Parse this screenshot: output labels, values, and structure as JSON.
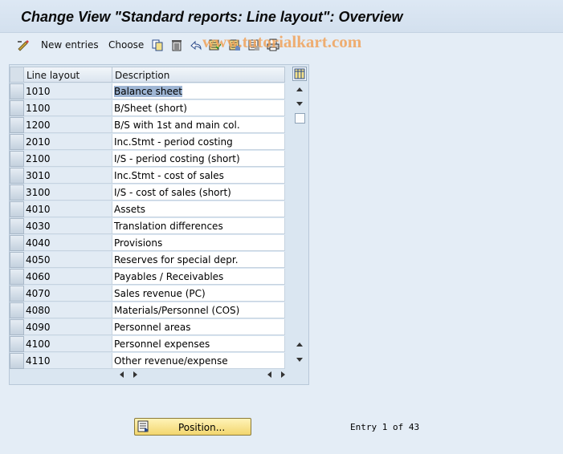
{
  "window": {
    "title": "Change View \"Standard reports: Line layout\": Overview"
  },
  "toolbar": {
    "new_entries_label": "New entries",
    "choose_label": "Choose",
    "icons": [
      "glasses-pencil-icon",
      "copy-icon",
      "delete-icon",
      "undo-icon",
      "select-all-icon",
      "select-block-icon",
      "deselect-all-icon",
      "print-icon"
    ]
  },
  "watermark": {
    "text": "www.tutorialkart.com",
    "color": "#f0a35a"
  },
  "table": {
    "columns": [
      "Line layout",
      "Description"
    ],
    "rows": [
      {
        "key": "1010",
        "desc": "Balance sheet",
        "selected": true
      },
      {
        "key": "1100",
        "desc": "B/Sheet (short)"
      },
      {
        "key": "1200",
        "desc": "B/S with 1st and main col."
      },
      {
        "key": "2010",
        "desc": "Inc.Stmt - period costing"
      },
      {
        "key": "2100",
        "desc": "I/S - period costing (short)"
      },
      {
        "key": "3010",
        "desc": "Inc.Stmt - cost of sales"
      },
      {
        "key": "3100",
        "desc": "I/S - cost of sales (short)"
      },
      {
        "key": "4010",
        "desc": "Assets"
      },
      {
        "key": "4030",
        "desc": "Translation differences"
      },
      {
        "key": "4040",
        "desc": "Provisions"
      },
      {
        "key": "4050",
        "desc": "Reserves for special depr."
      },
      {
        "key": "4060",
        "desc": "Payables / Receivables"
      },
      {
        "key": "4070",
        "desc": "Sales revenue (PC)"
      },
      {
        "key": "4080",
        "desc": "Materials/Personnel (COS)"
      },
      {
        "key": "4090",
        "desc": "Personnel areas"
      },
      {
        "key": "4100",
        "desc": "Personnel expenses"
      },
      {
        "key": "4110",
        "desc": "Other revenue/expense"
      }
    ]
  },
  "footer": {
    "position_label": "Position...",
    "entry_text": "Entry 1 of 43"
  },
  "colors": {
    "background": "#e4edf6",
    "key_cell": "#e2ebf4",
    "selection": "#9fb6d4",
    "button_yellow": "#f2d66e"
  }
}
